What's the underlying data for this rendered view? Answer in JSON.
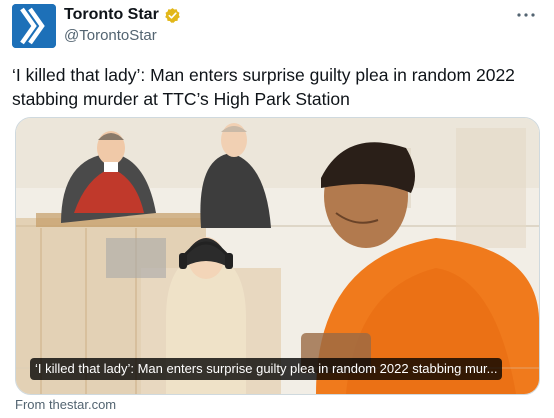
{
  "account": {
    "display_name": "Toronto Star",
    "handle": "@TorontoStar",
    "brand_color": "#1d70b8",
    "verified_color": "#e2b719",
    "avatar_icon": "toronto-star-chevron-logo",
    "verified_icon": "verified-badge-icon"
  },
  "more_icon": "more-options-icon",
  "tweet": {
    "text": "‘I killed that lady’: Man enters surprise guilty plea in random 2022 stabbing murder at TTC’s High Park Station"
  },
  "card": {
    "image_description_icon": "courtroom-sketch-illustration",
    "caption": "‘I killed that lady’: Man enters surprise guilty plea in random 2022 stabbing mur...",
    "source": "From thestar.com"
  }
}
